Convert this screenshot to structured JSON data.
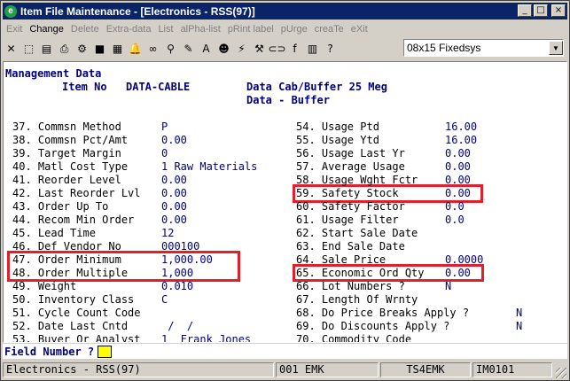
{
  "window": {
    "title": "Item File Maintenance - [Electronics - RSS(97)]",
    "minimize_glyph": "_",
    "maximize_glyph": "□",
    "close_glyph": "×"
  },
  "menu": [
    {
      "label": "Exit",
      "active": false
    },
    {
      "label": "Change",
      "active": true
    },
    {
      "label": "Delete",
      "active": false
    },
    {
      "label": "Extra-data",
      "active": false
    },
    {
      "label": "List",
      "active": false
    },
    {
      "label": "alPha-list",
      "active": false
    },
    {
      "label": "pRint label",
      "active": false
    },
    {
      "label": "pUrge",
      "active": false
    },
    {
      "label": "creaTe",
      "active": false
    },
    {
      "label": "eXit",
      "active": false
    }
  ],
  "toolbar": {
    "icons": [
      "close-icon",
      "select-icon",
      "document-icon",
      "printer-icon",
      "settings-icon",
      "stop-icon",
      "form-icon",
      "bell-icon",
      "binoculars-icon",
      "search-icon",
      "edit-icon",
      "font-icon",
      "portrait-icon",
      "lightning-icon",
      "wrench-icon",
      "link-icon",
      "function-icon",
      "book-icon",
      "help-icon"
    ],
    "glyphs": [
      "✕",
      "⬚",
      "▤",
      "⎙",
      "⚙",
      "■",
      "▦",
      "🔔",
      "∞",
      "⚲",
      "✎",
      "A",
      "☻",
      "⚡",
      "⚒",
      "⊂⊃",
      "f",
      "▥",
      "?"
    ],
    "font_combo_value": "08x15 Fixedsys"
  },
  "screen": {
    "header": {
      "section": "Management Data",
      "item_no_label": "Item No",
      "item_no_value": "DATA-CABLE",
      "description1": "Data Cab/Buffer 25 Meg",
      "description2": "Data - Buffer"
    },
    "left_fields": [
      {
        "label": "37. Commsn Method",
        "value": "P"
      },
      {
        "label": "38. Commsn Pct/Amt",
        "value": "0.00"
      },
      {
        "label": "39. Target Margin",
        "value": "0"
      },
      {
        "label": "40. Matl Cost Type",
        "value": "1 Raw Materials"
      },
      {
        "label": "41. Reorder Level",
        "value": "0.00"
      },
      {
        "label": "42. Last Reorder Lvl",
        "value": "0.00"
      },
      {
        "label": "43. Order Up To",
        "value": "0.00"
      },
      {
        "label": "44. Recom Min Order",
        "value": "0.00"
      },
      {
        "label": "45. Lead Time",
        "value": "12"
      },
      {
        "label": "46. Def Vendor No",
        "value": "000100"
      },
      {
        "label": "47. Order Minimum",
        "value": "1,000.00"
      },
      {
        "label": "48. Order Multiple",
        "value": "1,000"
      },
      {
        "label": "49. Weight",
        "value": "0.010"
      },
      {
        "label": "50. Inventory Class",
        "value": "C"
      },
      {
        "label": "51. Cycle Count Code",
        "value": ""
      },
      {
        "label": "52. Date Last Cntd",
        "value": " /  /"
      },
      {
        "label": "53. Buyer Or Analyst",
        "value": "1  Frank Jones"
      }
    ],
    "right_fields": [
      {
        "label": "54. Usage Ptd",
        "value": "16.00"
      },
      {
        "label": "55. Usage Ytd",
        "value": "16.00"
      },
      {
        "label": "56. Usage Last Yr",
        "value": "0.00"
      },
      {
        "label": "57. Average Usage",
        "value": "0.00"
      },
      {
        "label": "58. Usage Wght Fctr",
        "value": "0.00"
      },
      {
        "label": "59. Safety Stock",
        "value": "0.00"
      },
      {
        "label": "60. Safety Factor",
        "value": "0.0"
      },
      {
        "label": "61. Usage Filter",
        "value": "0.0"
      },
      {
        "label": "62. Start Sale Date",
        "value": ""
      },
      {
        "label": "63. End Sale Date",
        "value": ""
      },
      {
        "label": "64. Sale Price",
        "value": "0.0000"
      },
      {
        "label": "65. Economic Ord Qty",
        "value": "0.00"
      },
      {
        "label": "66. Lot Numbers ?",
        "value": "N"
      },
      {
        "label": "67. Length Of Wrnty",
        "value": ""
      },
      {
        "label": "68. Do Price Breaks Apply ?",
        "value": "N"
      },
      {
        "label": "69. Do Discounts Apply ?",
        "value": "N"
      },
      {
        "label": "70. Commodity Code",
        "value": ""
      }
    ],
    "highlight_color": "#e0202a"
  },
  "field_prompt": "Field Number ?",
  "status": {
    "company": "Electronics - RSS(97)",
    "user": "001 EMK",
    "terminal": "TS4EMK",
    "program": "IM0101"
  }
}
